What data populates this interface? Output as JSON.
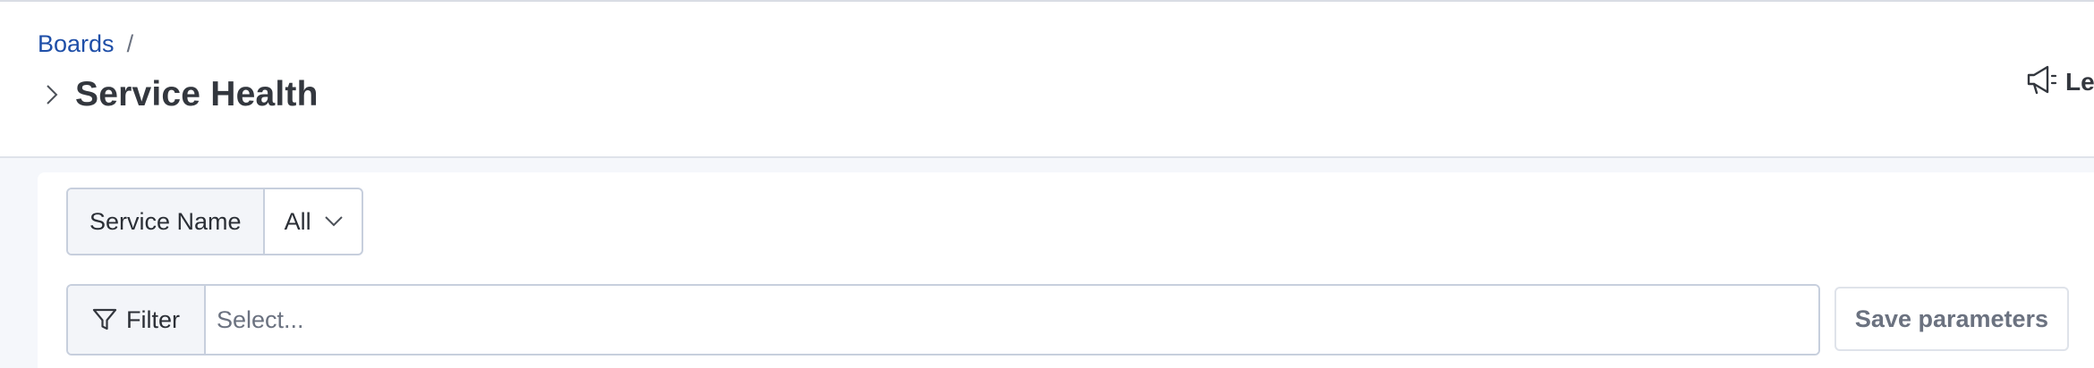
{
  "header": {
    "breadcrumb": {
      "link": "Boards",
      "separator": "/"
    },
    "title": "Service Health",
    "announcement_label": "Le"
  },
  "parameters": {
    "service_name": {
      "label": "Service Name",
      "value": "All"
    }
  },
  "filter": {
    "button_label": "Filter",
    "placeholder": "Select..."
  },
  "actions": {
    "save_label": "Save parameters"
  },
  "icons": {
    "expand": "chevron-right-icon",
    "announcement": "megaphone-icon",
    "dropdown": "chevron-down-icon",
    "filter": "funnel-icon"
  }
}
